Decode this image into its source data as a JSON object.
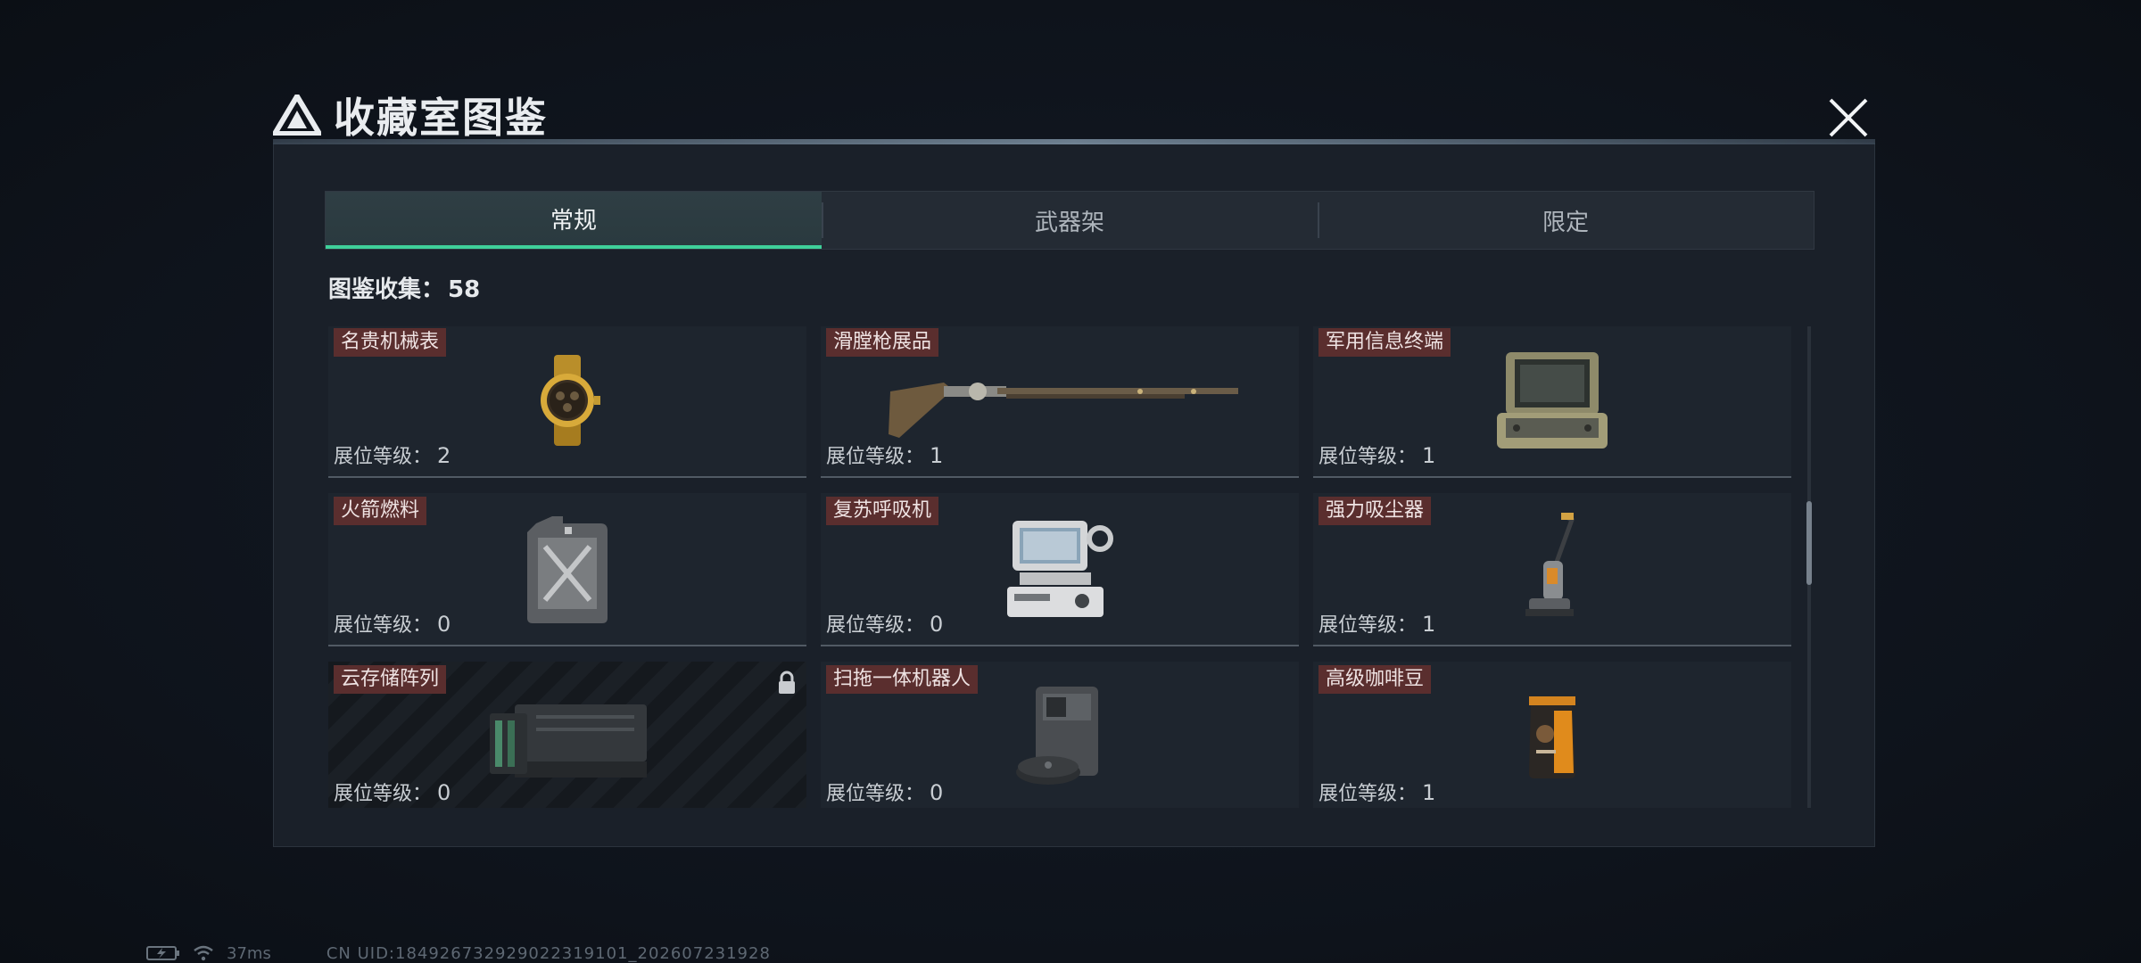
{
  "header": {
    "title": "收藏室图鉴",
    "close_icon": "close-icon",
    "logo_icon": "triangle-logo-icon"
  },
  "tabs": [
    {
      "label": "常规",
      "active": true
    },
    {
      "label": "武器架",
      "active": false
    },
    {
      "label": "限定",
      "active": false
    }
  ],
  "collection": {
    "label": "图鉴收集：",
    "count": "58"
  },
  "level_label": "展位等级：",
  "items": [
    {
      "name": "名贵机械表",
      "level": "2",
      "icon": "gold-watch-icon",
      "locked": false
    },
    {
      "name": "滑膛枪展品",
      "level": "1",
      "icon": "musket-icon",
      "locked": false
    },
    {
      "name": "军用信息终端",
      "level": "1",
      "icon": "rugged-terminal-icon",
      "locked": false
    },
    {
      "name": "火箭燃料",
      "level": "0",
      "icon": "fuel-canister-icon",
      "locked": false
    },
    {
      "name": "复苏呼吸机",
      "level": "0",
      "icon": "ventilator-icon",
      "locked": false
    },
    {
      "name": "强力吸尘器",
      "level": "1",
      "icon": "vacuum-cleaner-icon",
      "locked": false
    },
    {
      "name": "云存储阵列",
      "level": "0",
      "icon": "storage-array-icon",
      "locked": true
    },
    {
      "name": "扫拖一体机器人",
      "level": "0",
      "icon": "robot-vacuum-icon",
      "locked": false
    },
    {
      "name": "高级咖啡豆",
      "level": "1",
      "icon": "coffee-bag-icon",
      "locked": false
    }
  ],
  "status": {
    "ping": "37ms",
    "uid": "CN UID:1849267329290223191​01_202607231928"
  },
  "colors": {
    "accent": "#3fd09a",
    "name_tag": "#5a2e2e",
    "panel": "#1a2029",
    "background": "#101620"
  }
}
